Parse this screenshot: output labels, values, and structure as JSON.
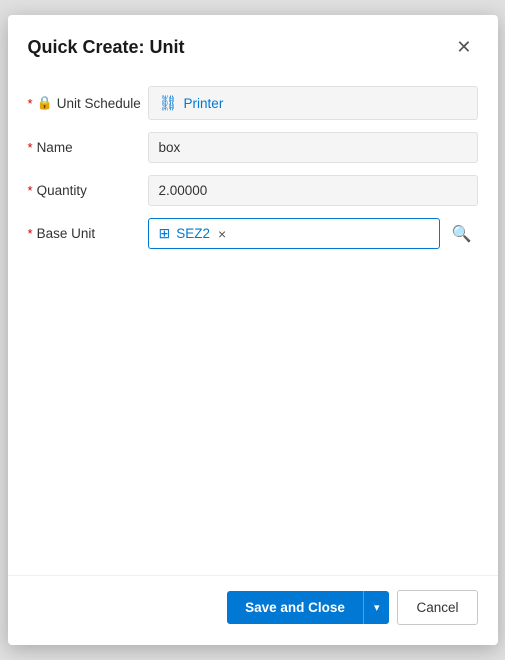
{
  "dialog": {
    "title": "Quick Create: Unit",
    "close_label": "×"
  },
  "form": {
    "unit_schedule": {
      "label": "Unit Schedule",
      "required": true,
      "locked": true,
      "value": "Printer"
    },
    "name": {
      "label": "Name",
      "required": true,
      "value": "box"
    },
    "quantity": {
      "label": "Quantity",
      "required": true,
      "value": "2.00000"
    },
    "base_unit": {
      "label": "Base Unit",
      "required": true,
      "value": "SEZ2"
    }
  },
  "footer": {
    "save_label": "Save and Close",
    "cancel_label": "Cancel"
  },
  "icons": {
    "close": "✕",
    "lock": "🔒",
    "link": "🔗",
    "entity": "⊞",
    "search": "🔍",
    "chevron": "▾"
  }
}
